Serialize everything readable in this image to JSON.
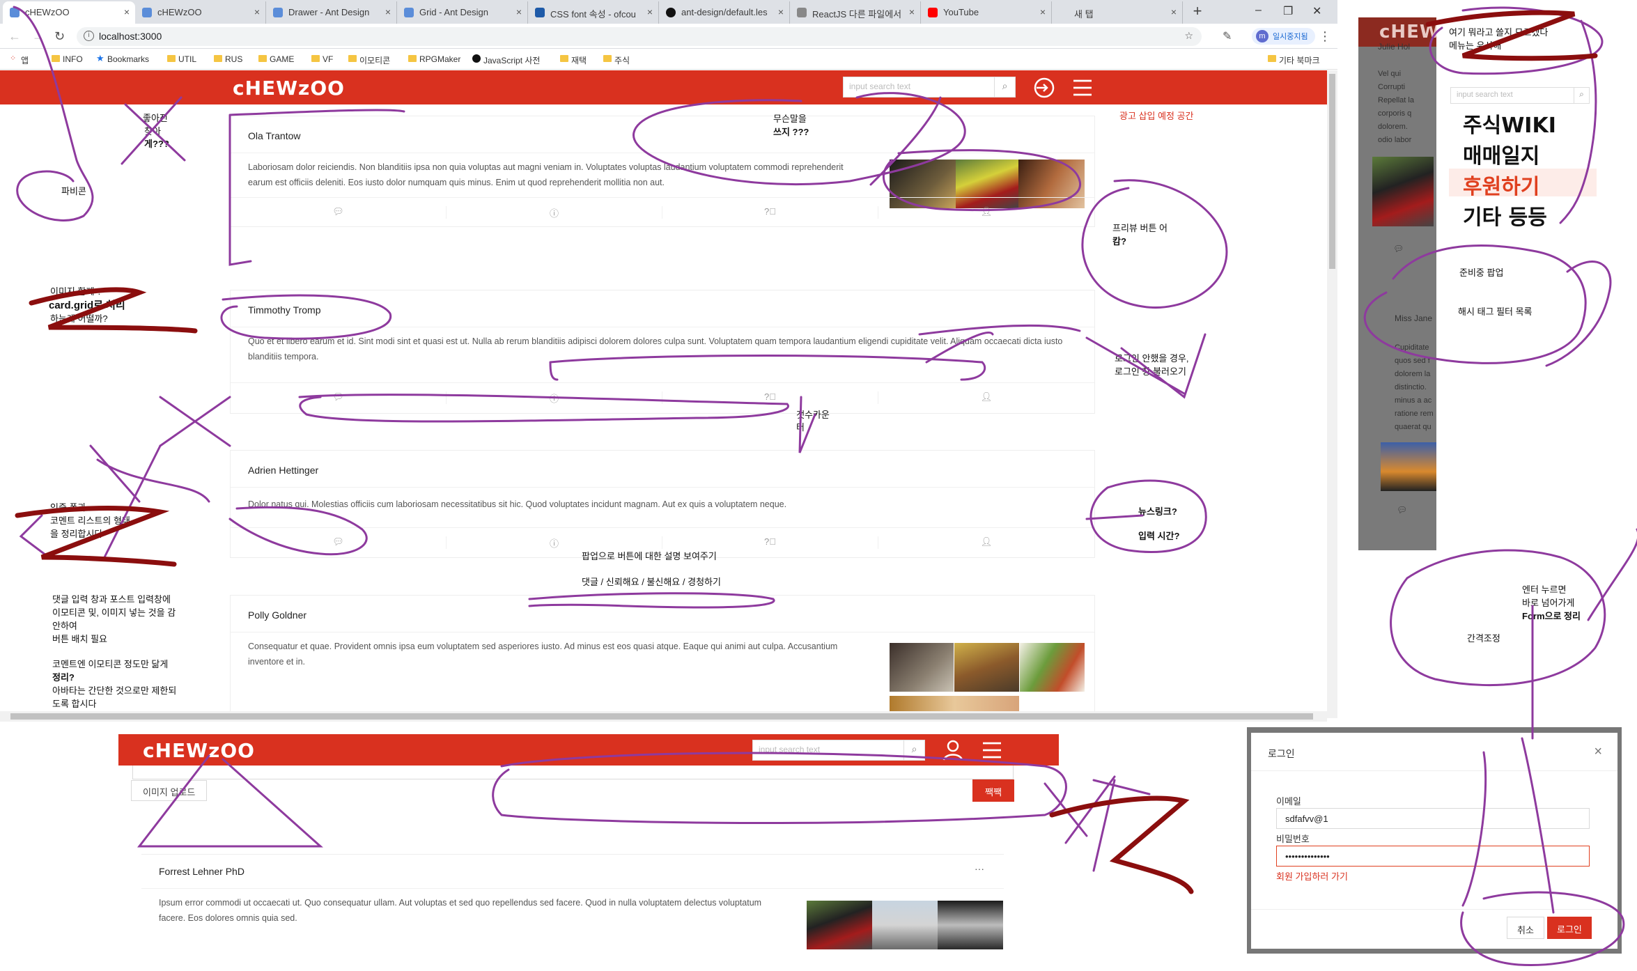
{
  "browser": {
    "tabs": [
      "cHEWzOO",
      "cHEWzOO",
      "Drawer - Ant Design",
      "Grid - Ant Design",
      "CSS font 속성 - ofcou",
      "ant-design/default.les",
      "ReactJS 다른 파일에서",
      "YouTube",
      "새 탭"
    ],
    "tab_close": "×",
    "new_tab": "+",
    "url": "localhost:3000",
    "pause_label": "일시중지됨",
    "pause_avatar": "m",
    "bookmarks": [
      "앱",
      "INFO",
      "Bookmarks",
      "UTIL",
      "RUS",
      "GAME",
      "VF",
      "이모티콘",
      "RPGMaker",
      "JavaScript 사전",
      "재택",
      "주식"
    ],
    "other_bookmarks": "기타 북마크"
  },
  "header": {
    "logo": "cHEWzOO",
    "search_placeholder": "input search text"
  },
  "ad_space": "광고 삽입 예정 공간",
  "posts": [
    {
      "author": "Ola Trantow",
      "text": "Laboriosam dolor reiciendis. Non blanditiis ipsa non quia voluptas aut magni veniam in. Voluptates voluptas laudantium voluptatem commodi reprehenderit earum est officiis deleniti. Eos iusto dolor numquam quis minus. Enim ut quod reprehenderit mollitia non aut."
    },
    {
      "author": "Timmothy Tromp",
      "text": "Quo et et libero earum et id. Sint modi sint et quasi est ut. Nulla ab rerum blanditiis adipisci dolorem dolores culpa sunt. Voluptatem quam tempora laudantium eligendi cupiditate velit. Aliquam occaecati dicta iusto blanditiis tempora."
    },
    {
      "author": "Adrien Hettinger",
      "text": "Dolor natus qui. Molestias officiis cum laboriosam necessitatibus sit hic. Quod voluptates incidunt magnam. Aut ex quis a voluptatem neque."
    },
    {
      "author": "Polly Goldner",
      "text": "Consequatur et quae. Provident omnis ipsa eum voluptatem sed asperiores iusto. Ad minus est eos quasi atque. Eaque qui animi aut culpa. Accusantium inventore et in."
    }
  ],
  "notes": {
    "n1": "파비콘",
    "n2a": "좋아진",
    "n2b": "찾아",
    "n2c": "게???",
    "n3a": "무슨말을",
    "n3b": "쓰지 ???",
    "n4a": "프리뷰 버튼 어",
    "n4b": "캄?",
    "n5a": "이미지 함께 ?",
    "n5b": "card.grid로 처리",
    "n5c": "하는게 어떨까?",
    "n6a": "로그인 안했을 경우,",
    "n6b": "로그인 창 불러오기",
    "n7a": "갯수카운",
    "n7b": "터",
    "n8a": "인증 폼과",
    "n8b": "코멘트 리스트의 형태",
    "n8c": "을 정리합시다",
    "n9": "뉴스링크?",
    "n10": "입력 시간?",
    "n11": "팝업으로 버튼에 대한 설명 보여주기",
    "n12": "댓글 / 신뢰해요 / 불신해요 / 경청하기",
    "n13a": "댓글 입력 창과 포스트 입력창에",
    "n13b": "이모티콘 및, 이미지 넣는 것을 감",
    "n13c": "안하여",
    "n13d": "버튼 배치 필요",
    "n14a": "코멘트엔 이모티콘 정도만 닮게",
    "n14b": "정리?",
    "n14c": "아바타는 간단한 것으로만 제한되",
    "n14d": "도록 합시다",
    "n15a": "엔터 누르면",
    "n15b": "바로 넘어가게",
    "n15c": "Form으로 정리",
    "n16": "간격조정",
    "n17a": "여기 뭐라고 쓸지 모르겠다",
    "n17b": "메뉴는 유사해",
    "n18": "준비중 팝업",
    "n19": "해시 태그 필터 목록"
  },
  "drawer": {
    "logo": "cHEW",
    "search_placeholder": "input search text",
    "menu": [
      "주식WIKI",
      "매매일지",
      "후원하기",
      "기타 등등"
    ],
    "bg_names": [
      "Julie Hol",
      "Miss Jane"
    ],
    "bg_text1": [
      "Vel qui",
      "Corrupti",
      "Repellat la",
      "corporis q",
      "dolorem.",
      "odio labor"
    ],
    "bg_text2": [
      "Cupiditate",
      "quos sed f",
      "dolorem la",
      "distinctio.",
      "minus a ac",
      "ratione rem",
      "quaerat qu"
    ]
  },
  "editor": {
    "upload_label": "이미지 업로드",
    "submit_label": "짹짹",
    "post_author": "Forrest Lehner PhD",
    "post_more": "···",
    "post_text": "Ipsum error commodi ut occaecati ut. Quo consequatur ullam. Aut voluptas et sed quo repellendus sed facere. Quod in nulla voluptatem delectus voluptatum facere. Eos dolores omnis quia sed."
  },
  "login": {
    "title": "로그인",
    "close": "×",
    "email_label": "이메일",
    "email_value": "sdfafvv@1",
    "password_label": "비밀번호",
    "password_value": "••••••••••••••",
    "signup_link": "회원 가입하러 가기",
    "cancel": "취소",
    "ok": "로그인"
  },
  "colors": {
    "brand": "#d9311f",
    "ink_purple": "#8e3a9e",
    "ink_red": "#8b0e0e"
  }
}
